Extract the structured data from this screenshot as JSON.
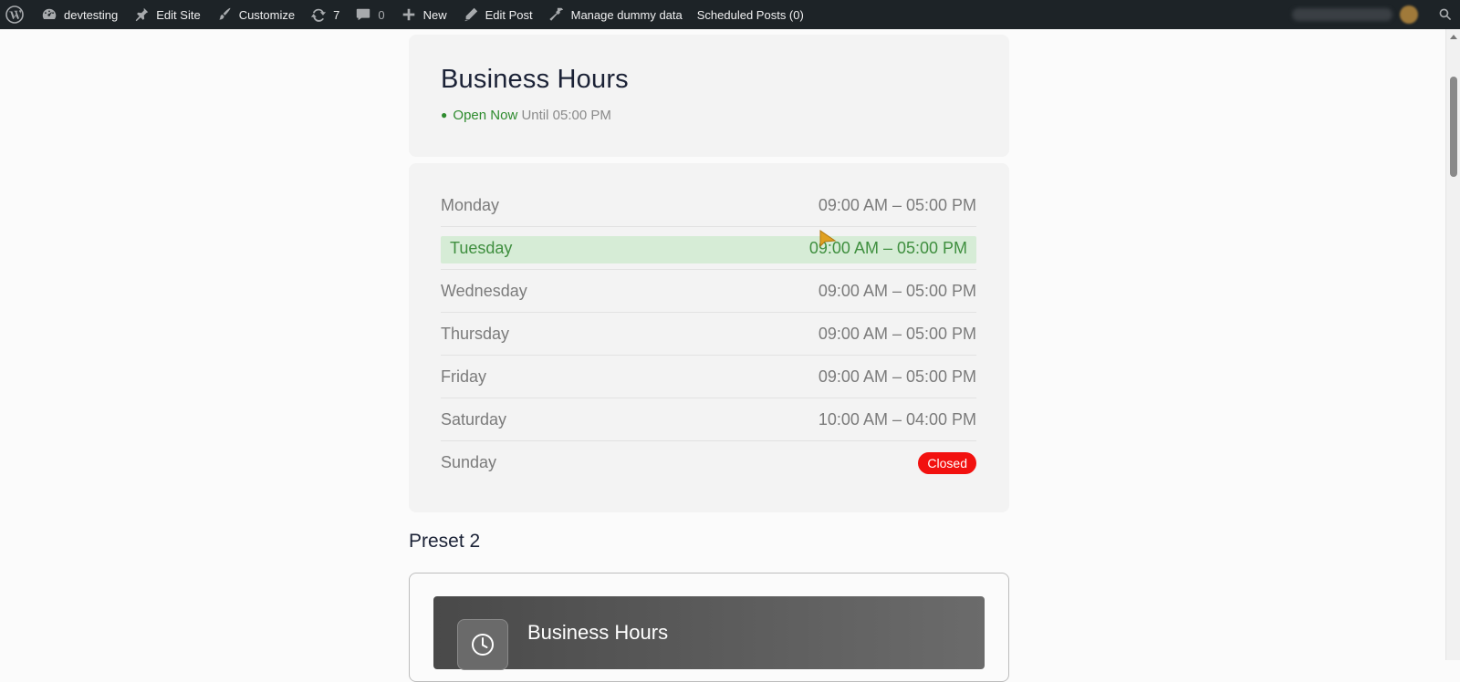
{
  "adminbar": {
    "site_name": "devtesting",
    "edit_site": "Edit Site",
    "customize": "Customize",
    "updates_count": "7",
    "comments_count": "0",
    "new_label": "New",
    "edit_post": "Edit Post",
    "manage_dummy": "Manage dummy data",
    "scheduled_posts": "Scheduled Posts (0)"
  },
  "header": {
    "title": "Business Hours",
    "status_dot": "●",
    "status_text": "Open Now",
    "status_until": "Until 05:00 PM"
  },
  "hours": [
    {
      "day": "Monday",
      "time": "09:00 AM – 05:00 PM"
    },
    {
      "day": "Tuesday",
      "time": "09:00 AM – 05:00 PM"
    },
    {
      "day": "Wednesday",
      "time": "09:00 AM – 05:00 PM"
    },
    {
      "day": "Thursday",
      "time": "09:00 AM – 05:00 PM"
    },
    {
      "day": "Friday",
      "time": "09:00 AM – 05:00 PM"
    },
    {
      "day": "Saturday",
      "time": "10:00 AM – 04:00 PM"
    },
    {
      "day": "Sunday",
      "badge": "Closed"
    }
  ],
  "preset2": {
    "heading": "Preset 2",
    "title": "Business Hours"
  },
  "colors": {
    "adminbar_bg": "#1d2327",
    "open_green": "#2e8b2e",
    "today_highlight": "#d6ecd6",
    "closed_red": "#f2110f"
  }
}
